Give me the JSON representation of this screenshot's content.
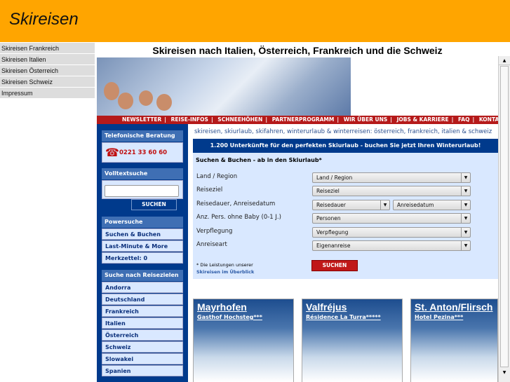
{
  "header": {
    "logo": "Skireisen"
  },
  "leftnav": [
    "Skireisen Frankreich",
    "Skireisen Italien",
    "Skireisen Österreich",
    "Skireisen Schweiz",
    "Impressum"
  ],
  "page": {
    "title": "Skireisen nach Italien, Österreich, Frankreich und die Schweiz"
  },
  "topnav": [
    "NEWSLETTER",
    "REISE-INFOS",
    "SCHNEEHÖHEN",
    "PARTNERPROGRAMM",
    "WIR ÜBER UNS",
    "JOBS & KARRIERE",
    "FAQ",
    "KONTAKT"
  ],
  "sidebar": {
    "phone_heading": "Telefonische Beratung",
    "phone": "0221 33 60 60",
    "search_heading": "Volltextsuche",
    "search_button": "SUCHEN",
    "power_heading": "Powersuche",
    "power_items": [
      "Suchen & Buchen",
      "Last-Minute & More",
      "Merkzettel: 0"
    ],
    "dest_heading": "Suche nach Reisezielen",
    "destinations": [
      "Andorra",
      "Deutschland",
      "Frankreich",
      "Italien",
      "Österreich",
      "Schweiz",
      "Slowakei",
      "Spanien"
    ]
  },
  "main": {
    "keywords": "skireisen, skiurlaub, skifahren, winterurlaub & winterreisen: österreich, frankreich, italien & schweiz",
    "promo": "1.200 Unterkünfte für den perfekten Skiurlaub - buchen Sie jetzt Ihren Winterurlaub!",
    "form": {
      "heading": "Suchen & Buchen - ab in den Skiurlaub*",
      "labels": [
        "Land / Region",
        "Reiseziel",
        "Reisedauer, Anreisedatum",
        "Anz. Pers. ohne Baby (0-1 J.)",
        "Verpflegung",
        "Anreiseart"
      ],
      "selects": {
        "land": "Land / Region",
        "ziel": "Reiseziel",
        "dauer": "Reisedauer",
        "datum": "Anreisedatum",
        "personen": "Personen",
        "verpflegung": "Verpflegung",
        "anreise": "Eigenanreise"
      },
      "note": "* Die Leistungen unserer",
      "note_link": "Skireisen im Überblick",
      "submit": "SUCHEN"
    },
    "cards": [
      {
        "name": "Mayrhofen",
        "hotel": "Gasthof Hochsteg***"
      },
      {
        "name": "Valfréjus",
        "hotel": "Résidence La Turra*****"
      },
      {
        "name": "St. Anton/Flirsch",
        "hotel": "Hotel Pezina***"
      }
    ]
  }
}
